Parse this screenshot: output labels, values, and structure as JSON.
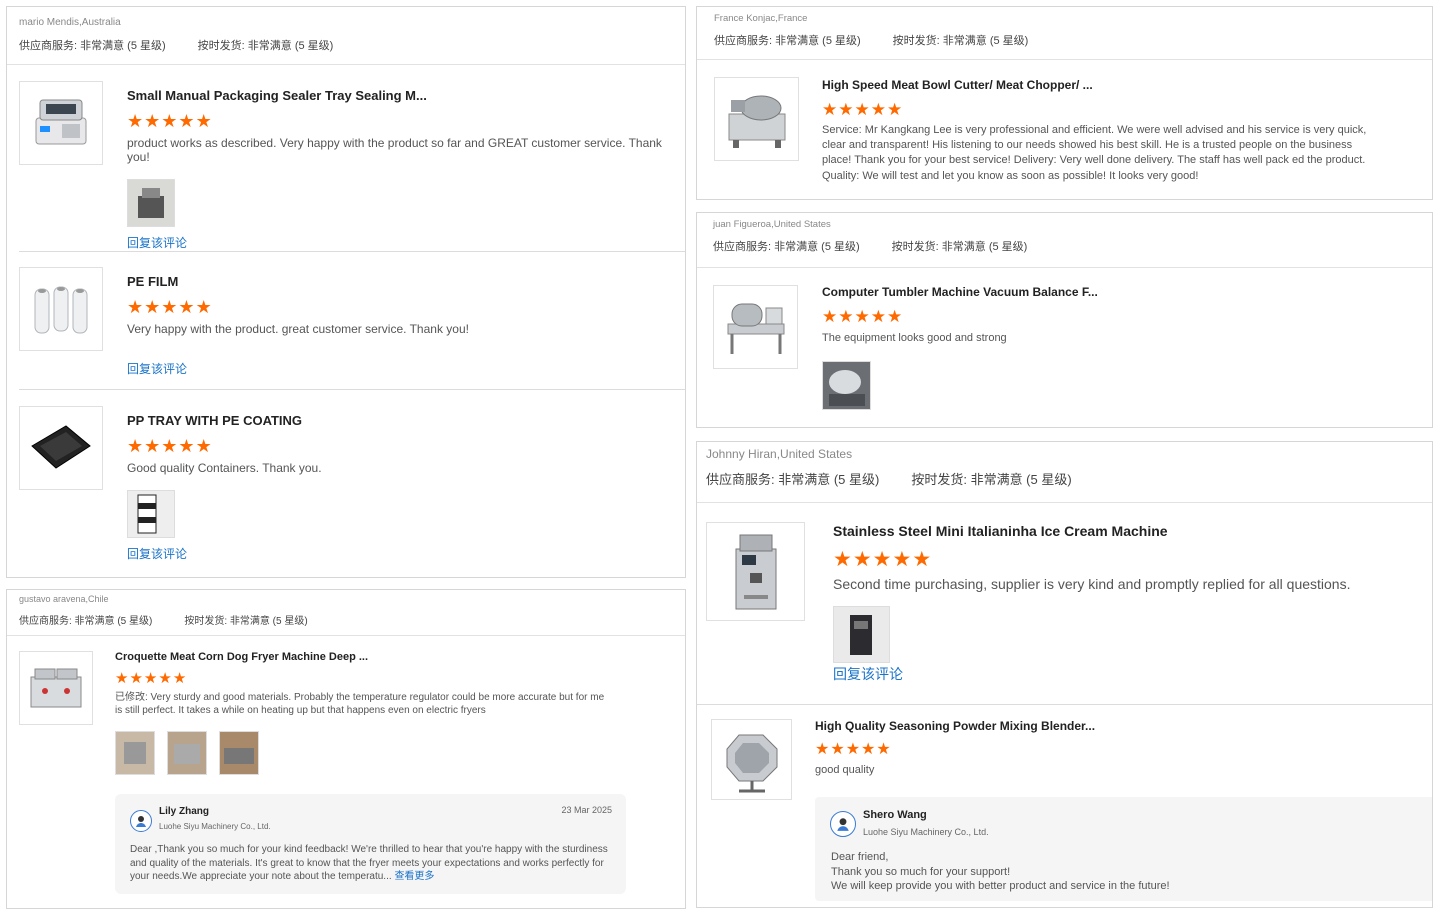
{
  "reply_label": "回复该评论",
  "star_glyph": "★",
  "colors": {
    "star": "#ff6a00",
    "link": "#1a73c9"
  },
  "cards": {
    "mario": {
      "reviewer": "mario Mendis,Australia",
      "supplier_service": "供应商服务: 非常满意 (5 星级)",
      "on_time": "按时发货: 非常满意 (5 星级)",
      "items": [
        {
          "title": "Small Manual Packaging Sealer Tray Sealing M...",
          "stars": 5,
          "text": "product works as described. Very happy with the product so far and GREAT customer service. Thank you!",
          "thumb_icon": "tray-sealer-machine-icon",
          "photos": 1
        },
        {
          "title": "PE FILM",
          "stars": 5,
          "text": "Very happy with the product. great customer service. Thank you!",
          "thumb_icon": "film-rolls-icon",
          "photos": 0
        },
        {
          "title": "PP TRAY WITH PE COATING",
          "stars": 5,
          "text": "Good quality Containers. Thank you.",
          "thumb_icon": "black-tray-icon",
          "photos": 1
        }
      ]
    },
    "gustavo": {
      "reviewer": "gustavo aravena,Chile",
      "supplier_service": "供应商服务: 非常满意 (5 星级)",
      "on_time": "按时发货: 非常满意 (5 星级)",
      "item": {
        "title": "Croquette Meat Corn Dog Fryer Machine Deep ...",
        "stars": 5,
        "text": "已修改: Very sturdy and good materials. Probably the temperature regulator could be more accurate but for me is still perfect. It takes a while on heating up but that happens even on electric fryers",
        "thumb_icon": "fryer-machine-icon",
        "photos": 3
      },
      "reply": {
        "name": "Lily Zhang",
        "company": "Luohe Siyu Machinery Co., Ltd.",
        "date": "23 Mar 2025",
        "text": "Dear ,Thank you so much for your kind feedback!  We're thrilled to hear that you're happy with the sturdiness and quality of the materials.  It's great to know that the fryer meets your expectations and works perfectly for your needs.We appreciate your note about the temperatu...",
        "more": "查看更多"
      }
    },
    "france": {
      "reviewer": "France Konjac,France",
      "supplier_service": "供应商服务: 非常满意 (5 星级)",
      "on_time": "按时发货: 非常满意 (5 星级)",
      "item": {
        "title": "High Speed Meat Bowl Cutter/ Meat Chopper/ ...",
        "stars": 5,
        "text": "Service:   Mr Kangkang Lee is very professional and efficient. We were well advised and his service is very quick, clear and transparent! His listening to our needs showed his best skill. He is a trusted people on the business place! Thank you for your best service! Delivery:   Very well done delivery. The staff has well pack ed the product.  Quality:   We will test and let you know as soon as possible! It looks very good!",
        "thumb_icon": "bowl-cutter-icon"
      }
    },
    "juan": {
      "reviewer": "juan Figueroa,United States",
      "supplier_service": "供应商服务: 非常满意 (5 星级)",
      "on_time": "按时发货: 非常满意 (5 星级)",
      "item": {
        "title": "Computer Tumbler Machine Vacuum Balance F...",
        "stars": 5,
        "text": "The equipment looks good and strong",
        "thumb_icon": "tumbler-machine-icon",
        "photos": 1
      }
    },
    "johnny": {
      "reviewer": "Johnny Hiran,United States",
      "supplier_service": "供应商服务: 非常满意 (5 星级)",
      "on_time": "按时发货: 非常满意 (5 星级)",
      "items": [
        {
          "title": "Stainless Steel Mini Italianinha Ice Cream Machine",
          "stars": 5,
          "text": "Second time purchasing, supplier is very kind and promptly replied for all questions.",
          "thumb_icon": "ice-cream-machine-icon",
          "photos": 1
        },
        {
          "title": "High Quality Seasoning Powder Mixing Blender...",
          "stars": 5,
          "text": "good quality",
          "thumb_icon": "mixing-drum-icon"
        }
      ],
      "reply": {
        "name": "Shero Wang",
        "company": "Luohe Siyu Machinery Co., Ltd.",
        "text": "Dear friend,\nThank you so much for your support!\nWe will keep provide you with better product and service in the future!"
      }
    }
  }
}
